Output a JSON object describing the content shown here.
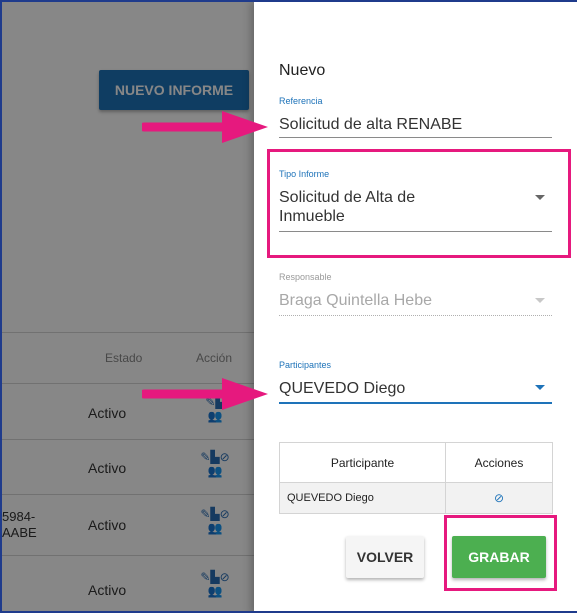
{
  "background": {
    "new_report_button": "NUEVO INFORME",
    "table": {
      "headers": {
        "status": "Estado",
        "action": "Acción"
      },
      "rows": [
        {
          "left": "",
          "status": "Activo"
        },
        {
          "left": "",
          "status": "Activo"
        },
        {
          "left": "5984-\nAABE",
          "status": "Activo"
        },
        {
          "left": "",
          "status": "Activo"
        }
      ]
    }
  },
  "drawer": {
    "title": "Nuevo",
    "referencia": {
      "label": "Referencia",
      "value": "Solicitud de alta RENABE"
    },
    "tipo_informe": {
      "label": "Tipo Informe",
      "value": "Solicitud de Alta de\nInmueble"
    },
    "responsable": {
      "label": "Responsable",
      "value": "Braga Quintella Hebe"
    },
    "participantes": {
      "label": "Participantes",
      "value": "QUEVEDO Diego"
    },
    "participants_table": {
      "headers": {
        "participant": "Participante",
        "actions": "Acciones"
      },
      "rows": [
        {
          "name": "QUEVEDO Diego",
          "action_icon": "block-icon"
        }
      ]
    },
    "buttons": {
      "back": "VOLVER",
      "save": "GRABAR"
    }
  },
  "colors": {
    "accent": "#1e73b9",
    "save": "#4caf50",
    "highlight": "#e6197e"
  }
}
